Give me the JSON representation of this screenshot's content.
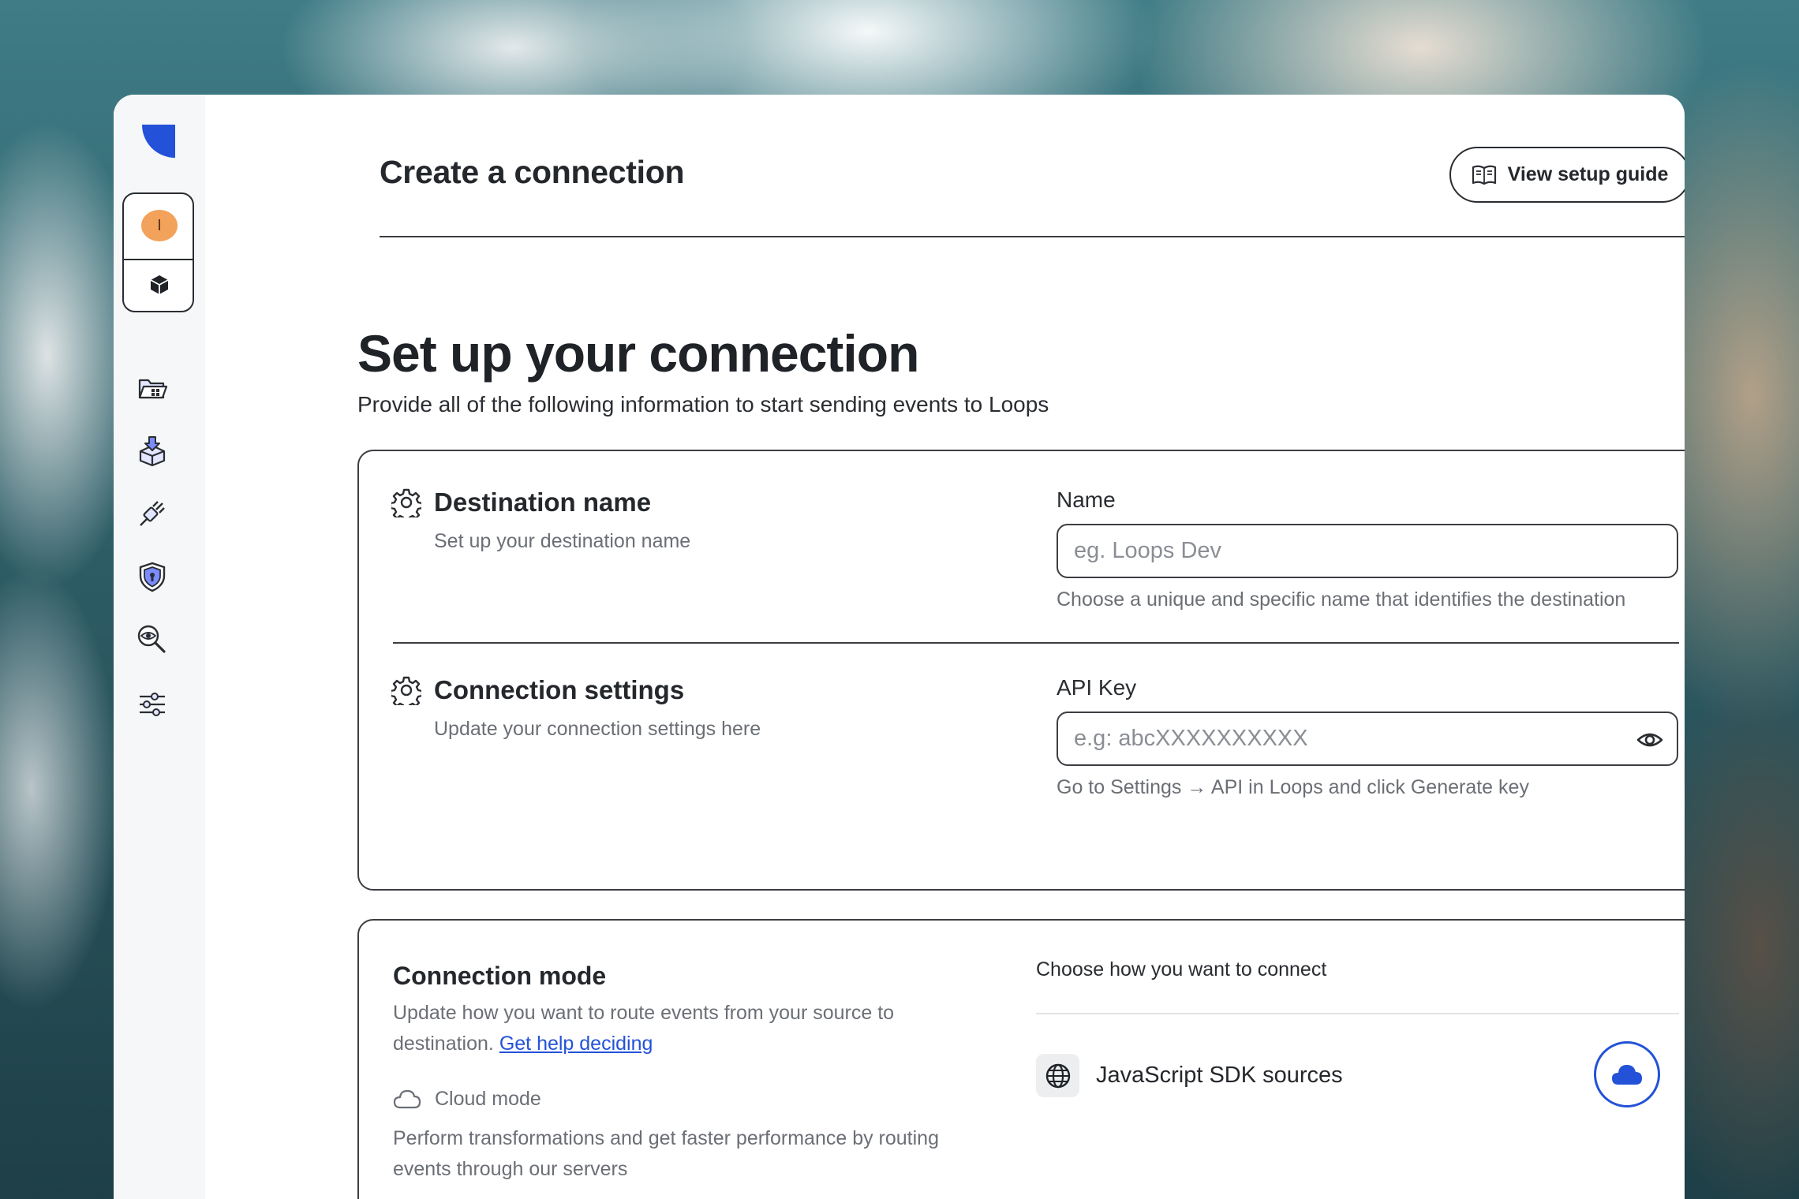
{
  "header": {
    "title": "Create a connection",
    "guide_button": "View setup guide"
  },
  "sidebar": {
    "avatar_initial": "I",
    "nav_icons": [
      "folder-grid-icon",
      "download-box-icon",
      "plug-icon",
      "shield-lock-icon",
      "eye-search-icon",
      "sliders-icon"
    ]
  },
  "page": {
    "title": "Set up your connection",
    "subtitle": "Provide all of the following information to start sending events to Loops"
  },
  "destination": {
    "title": "Destination name",
    "description": "Set up your destination name",
    "field_label": "Name",
    "placeholder": "eg. Loops Dev",
    "hint": "Choose a unique and specific name that identifies the destination"
  },
  "settings": {
    "title": "Connection settings",
    "description": "Update your connection settings here",
    "field_label": "API Key",
    "placeholder": "e.g: abcXXXXXXXXXX",
    "hint": "Go to Settings → API in Loops and click Generate key"
  },
  "mode": {
    "title": "Connection mode",
    "description": "Update how you want to route events from your source to destination.",
    "help_link": "Get help deciding",
    "cloud_label": "Cloud mode",
    "cloud_description": "Perform transformations and get faster performance by routing events through our servers",
    "choose_label": "Choose how you want to connect",
    "source_label": "JavaScript SDK sources"
  },
  "colors": {
    "accent": "#2352d8",
    "avatar": "#f2a25a",
    "border": "#3b3e42",
    "muted_text": "#6b6f75"
  }
}
